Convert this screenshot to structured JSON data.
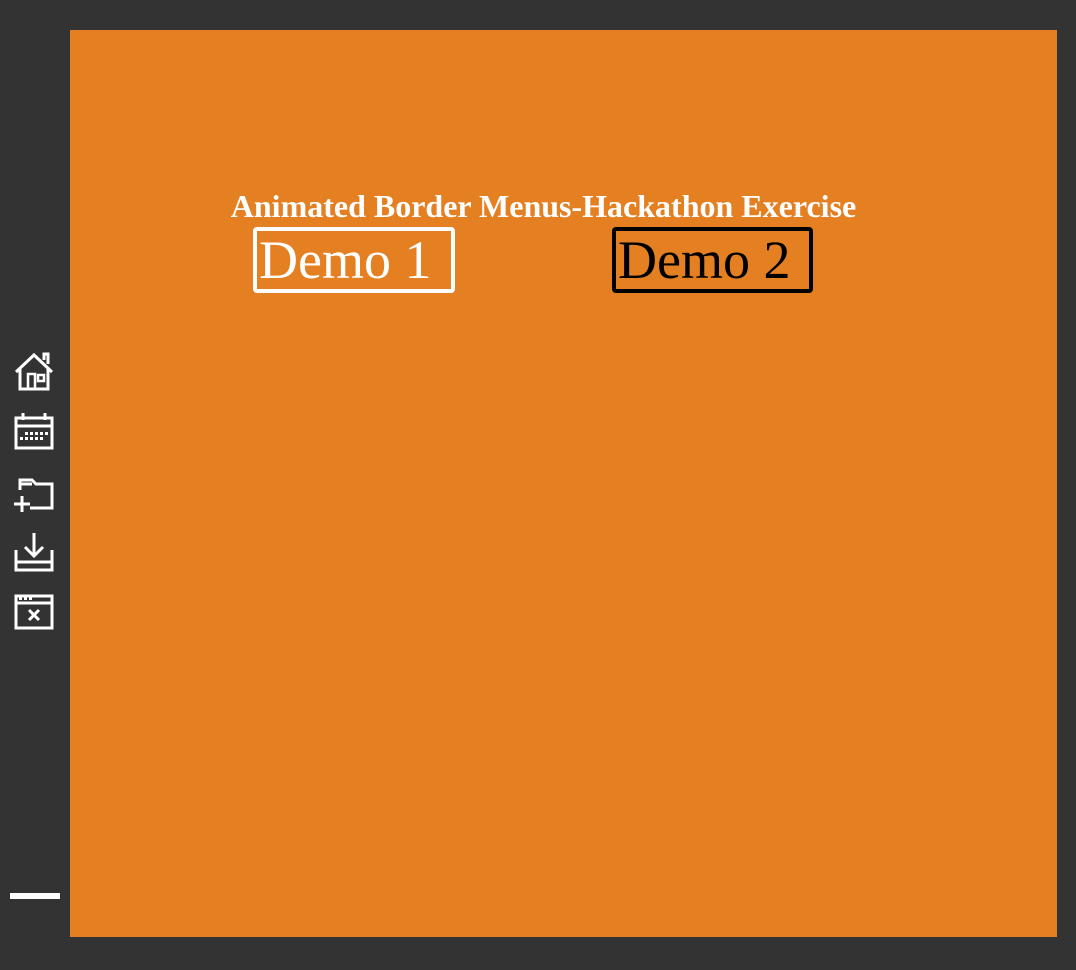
{
  "page": {
    "title": "Animated Border Menus-Hackathon Exercise",
    "background_color": "#e47f22"
  },
  "demos": [
    {
      "label": "Demo 1",
      "color": "#ffffff"
    },
    {
      "label": "Demo 2",
      "color": "#000000"
    }
  ],
  "sidebar": {
    "icons": [
      "home-icon",
      "calendar-icon",
      "add-folder-icon",
      "download-icon",
      "close-window-icon",
      "menu-bar-icon"
    ]
  }
}
